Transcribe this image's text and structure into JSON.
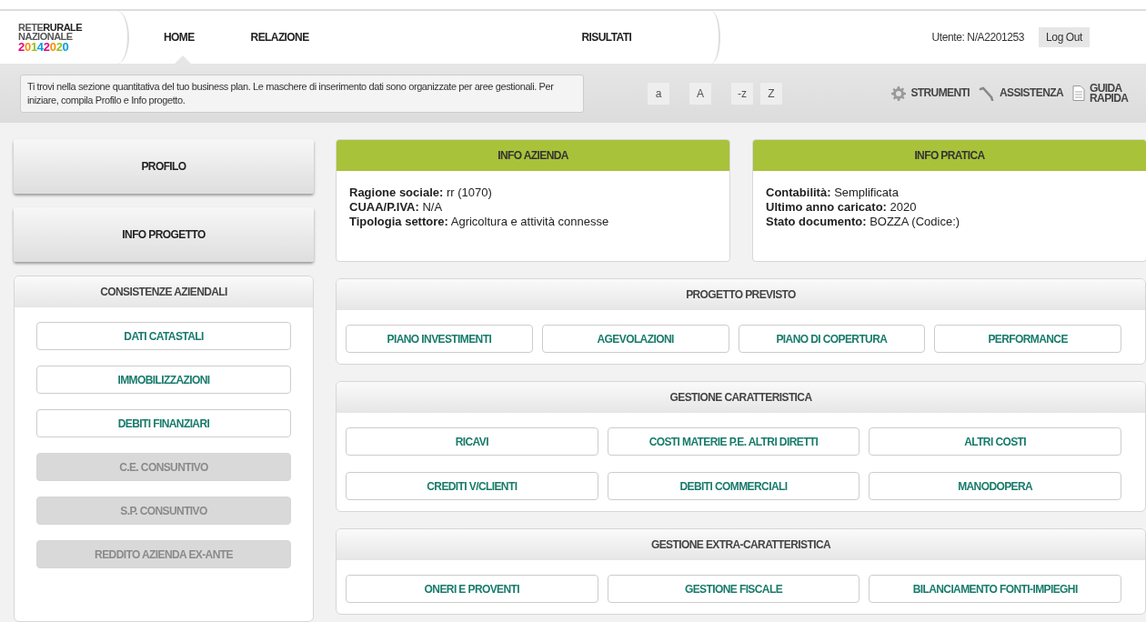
{
  "logo": {
    "word_1": "RETE",
    "word_2": "RURALE",
    "word_3": "NAZIONALE",
    "years": "20142020"
  },
  "nav": [
    {
      "label": "HOME",
      "selected": true
    },
    {
      "label": "RELAZIONE",
      "selected": false
    },
    {
      "label": "RISULTATI",
      "selected": false
    }
  ],
  "user": {
    "label": "Utente: N/A2201253",
    "logout": "Log Out"
  },
  "notice": "Ti trovi nella sezione quantitativa del tuo business plan. Le maschere di inserimento dati sono organizzate per aree gestionali. Per iniziare, compila Profilo e Info progetto.",
  "font_buttons": [
    "a",
    "A",
    "-z",
    "Z"
  ],
  "tools": [
    {
      "kind": "gear",
      "label": "STRUMENTI"
    },
    {
      "kind": "phone",
      "label": "ASSISTENZA"
    },
    {
      "kind": "document",
      "label": "GUIDA RAPIDA"
    }
  ],
  "main_buttons": [
    "PROFILO",
    "INFO PROGETTO"
  ],
  "consistenze": {
    "title": "CONSISTENZE AZIENDALI",
    "items": [
      {
        "label": "DATI CATASTALI",
        "disabled": false
      },
      {
        "label": "IMMOBILIZZAZIONI",
        "disabled": false
      },
      {
        "label": "DEBITI FINANZIARI",
        "disabled": false
      },
      {
        "label": "C.E. CONSUNTIVO",
        "disabled": true
      },
      {
        "label": "S.P. CONSUNTIVO",
        "disabled": true
      },
      {
        "label": "REDDITO AZIENDA EX-ANTE",
        "disabled": true
      }
    ]
  },
  "info_cards": [
    {
      "title": "INFO AZIENDA",
      "fields": [
        {
          "label": "Ragione sociale:",
          "value": "rr (1070)"
        },
        {
          "label": "CUAA/P.IVA:",
          "value": "N/A"
        },
        {
          "label": "Tipologia settore:",
          "value": "Agricoltura e attività connesse"
        }
      ]
    },
    {
      "title": "INFO PRATICA",
      "fields": [
        {
          "label": "Contabilità:",
          "value": "Semplificata"
        },
        {
          "label": "Ultimo anno caricato:",
          "value": "2020"
        },
        {
          "label": "Stato documento:",
          "value": "BOZZA (Codice:)"
        }
      ]
    }
  ],
  "sections": [
    {
      "title": "PROGETTO PREVISTO",
      "buttons": [
        "PIANO INVESTIMENTI",
        "AGEVOLAZIONI",
        "PIANO DI COPERTURA",
        "PERFORMANCE"
      ]
    },
    {
      "title": "GESTIONE CARATTERISTICA",
      "buttons": [
        "RICAVI",
        "COSTI MATERIE  P.E. ALTRI DIRETTI",
        "ALTRI COSTI",
        "CREDITI V/CLIENTI",
        "DEBITI COMMERCIALI",
        "MANODOPERA"
      ]
    },
    {
      "title": "GESTIONE EXTRA-CARATTERISTICA",
      "buttons": [
        "ONERI E PROVENTI",
        "GESTIONE FISCALE",
        "BILANCIAMENTO FONTI-IMPIEGHI"
      ]
    }
  ]
}
